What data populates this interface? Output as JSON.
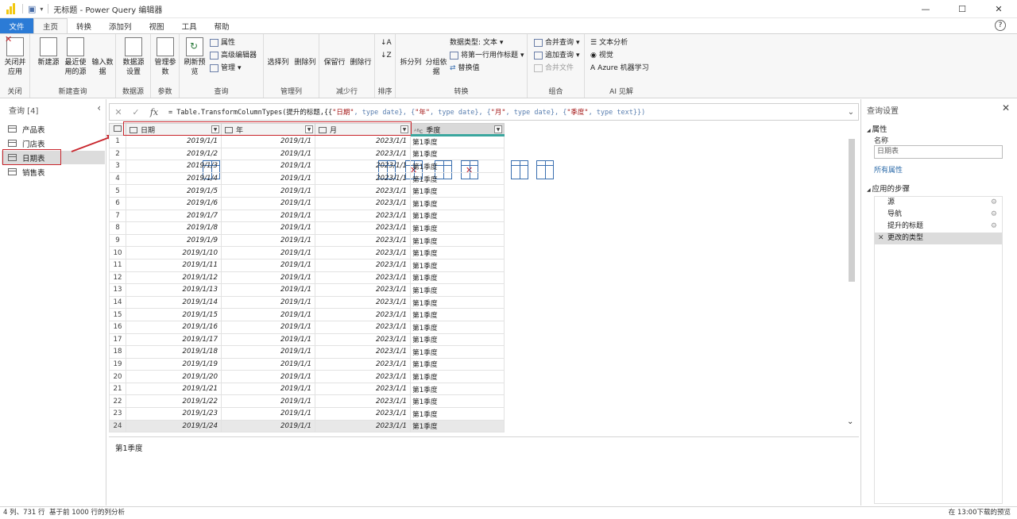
{
  "titlebar": {
    "title": "无标题 - Power Query 编辑器"
  },
  "tabs": [
    "文件",
    "主页",
    "转换",
    "添加列",
    "视图",
    "工具",
    "帮助"
  ],
  "ribbon": {
    "close": {
      "btn": "关闭并应用",
      "label": "关闭"
    },
    "newquery": {
      "new_source": "新建源",
      "recent": "最近使用的源",
      "enter": "输入数据",
      "label": "新建查询"
    },
    "datasource": {
      "settings": "数据源设置",
      "label": "数据源"
    },
    "params": {
      "manage": "管理参数",
      "label": "参数"
    },
    "query": {
      "refresh": "刷新预览",
      "props": "属性",
      "adv": "高级编辑器",
      "manage": "管理",
      "label": "查询"
    },
    "cols": {
      "choose": "选择列",
      "remove": "删除列",
      "label": "管理列"
    },
    "rows": {
      "keep": "保留行",
      "remove": "删除行",
      "label": "减少行"
    },
    "sort": {
      "label": "排序"
    },
    "transform": {
      "split": "拆分列",
      "group": "分组依据",
      "dtype": "数据类型: 文本",
      "first_row": "将第一行用作标题",
      "replace": "替换值",
      "label": "转换"
    },
    "combine": {
      "merge": "合并查询",
      "append": "追加查询",
      "files": "合并文件",
      "label": "组合"
    },
    "ai": {
      "text": "文本分析",
      "vision": "视觉",
      "azure": "Azure 机器学习",
      "label": "AI 见解"
    }
  },
  "left_panel": {
    "header": "查询 [4]",
    "queries": [
      "产品表",
      "门店表",
      "日期表",
      "销售表"
    ]
  },
  "formula": {
    "prefix": "= Table.TransformColumnTypes(提升的标题,{{",
    "parts": [
      "\"日期\"",
      ", type date}, {",
      "\"年\"",
      ", type date}, {",
      "\"月\"",
      ", type date}, {",
      "\"季度\"",
      ", type text}})"
    ]
  },
  "grid": {
    "columns": [
      "日期",
      "年",
      "月",
      "季度"
    ],
    "rows": [
      [
        "2019/1/1",
        "2019/1/1",
        "2023/1/1",
        "第1季度"
      ],
      [
        "2019/1/2",
        "2019/1/1",
        "2023/1/1",
        "第1季度"
      ],
      [
        "2019/1/3",
        "2019/1/1",
        "2023/1/1",
        "第1季度"
      ],
      [
        "2019/1/4",
        "2019/1/1",
        "2023/1/1",
        "第1季度"
      ],
      [
        "2019/1/5",
        "2019/1/1",
        "2023/1/1",
        "第1季度"
      ],
      [
        "2019/1/6",
        "2019/1/1",
        "2023/1/1",
        "第1季度"
      ],
      [
        "2019/1/7",
        "2019/1/1",
        "2023/1/1",
        "第1季度"
      ],
      [
        "2019/1/8",
        "2019/1/1",
        "2023/1/1",
        "第1季度"
      ],
      [
        "2019/1/9",
        "2019/1/1",
        "2023/1/1",
        "第1季度"
      ],
      [
        "2019/1/10",
        "2019/1/1",
        "2023/1/1",
        "第1季度"
      ],
      [
        "2019/1/11",
        "2019/1/1",
        "2023/1/1",
        "第1季度"
      ],
      [
        "2019/1/12",
        "2019/1/1",
        "2023/1/1",
        "第1季度"
      ],
      [
        "2019/1/13",
        "2019/1/1",
        "2023/1/1",
        "第1季度"
      ],
      [
        "2019/1/14",
        "2019/1/1",
        "2023/1/1",
        "第1季度"
      ],
      [
        "2019/1/15",
        "2019/1/1",
        "2023/1/1",
        "第1季度"
      ],
      [
        "2019/1/16",
        "2019/1/1",
        "2023/1/1",
        "第1季度"
      ],
      [
        "2019/1/17",
        "2019/1/1",
        "2023/1/1",
        "第1季度"
      ],
      [
        "2019/1/18",
        "2019/1/1",
        "2023/1/1",
        "第1季度"
      ],
      [
        "2019/1/19",
        "2019/1/1",
        "2023/1/1",
        "第1季度"
      ],
      [
        "2019/1/20",
        "2019/1/1",
        "2023/1/1",
        "第1季度"
      ],
      [
        "2019/1/21",
        "2019/1/1",
        "2023/1/1",
        "第1季度"
      ],
      [
        "2019/1/22",
        "2019/1/1",
        "2023/1/1",
        "第1季度"
      ],
      [
        "2019/1/23",
        "2019/1/1",
        "2023/1/1",
        "第1季度"
      ],
      [
        "2019/1/24",
        "2019/1/1",
        "2023/1/1",
        "第1季度"
      ]
    ]
  },
  "preview": {
    "value": "第1季度"
  },
  "settings": {
    "header": "查询设置",
    "props_title": "属性",
    "name_label": "名称",
    "name_value": "日期表",
    "all_props": "所有属性",
    "steps_title": "应用的步骤",
    "steps": [
      "源",
      "导航",
      "提升的标题",
      "更改的类型"
    ]
  },
  "status": {
    "cols_rows": "4 列、731 行",
    "profile": "基于前 1000 行的列分析",
    "download": "在 13:00下载的预览"
  },
  "colors": {
    "file_tab": "#2b7bd6",
    "highlight": "#c8252c",
    "teal": "#3aa69e",
    "pbi_yellow": "#f2c811"
  }
}
